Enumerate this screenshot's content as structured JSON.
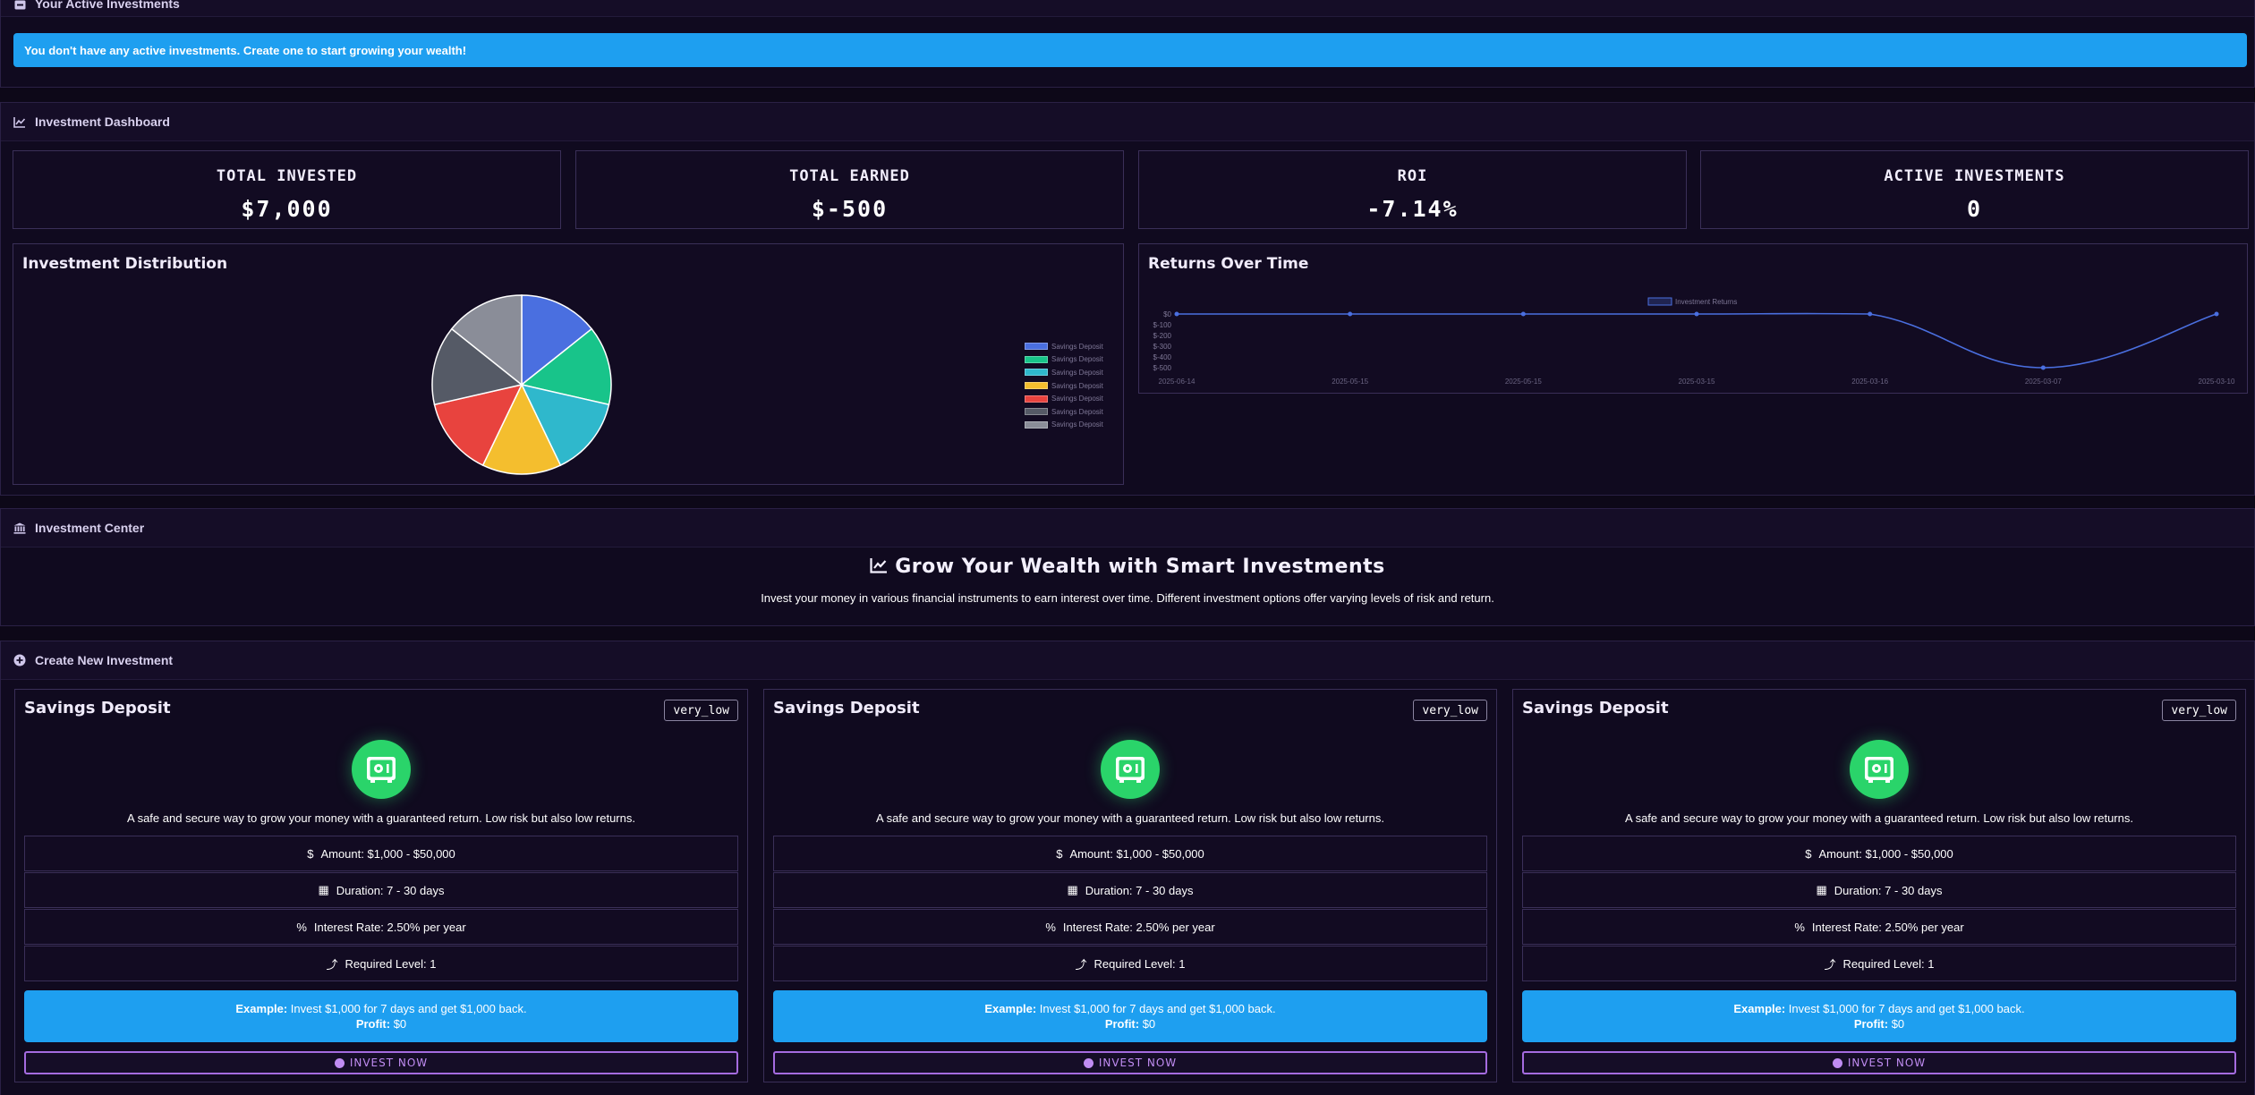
{
  "active": {
    "title": "Your Active Investments",
    "alert": "You don't have any active investments. Create one to start growing your wealth!"
  },
  "dashboard": {
    "title": "Investment Dashboard",
    "stats": [
      {
        "label": "TOTAL INVESTED",
        "value": "$7,000"
      },
      {
        "label": "TOTAL EARNED",
        "value": "$-500"
      },
      {
        "label": "ROI",
        "value": "-7.14%"
      },
      {
        "label": "ACTIVE INVESTMENTS",
        "value": "0"
      }
    ],
    "distribution": {
      "title": "Investment Distribution"
    },
    "returns": {
      "title": "Returns Over Time"
    }
  },
  "chart_data": [
    {
      "type": "pie",
      "title": "Investment Distribution",
      "labels": [
        "Savings Deposit",
        "Savings Deposit",
        "Savings Deposit",
        "Savings Deposit",
        "Savings Deposit",
        "Savings Deposit",
        "Savings Deposit"
      ],
      "values": [
        1000,
        1000,
        1000,
        1000,
        1000,
        1000,
        1000
      ],
      "colors": [
        "#4a6fe0",
        "#18c48a",
        "#2fb8cc",
        "#f4be2e",
        "#e8433e",
        "#555a66",
        "#8a8d98"
      ],
      "legend": "right"
    },
    {
      "type": "line",
      "title": "Returns Over Time",
      "series": [
        {
          "name": "Investment Returns",
          "values": [
            0,
            0,
            0,
            0,
            0,
            -500,
            0
          ]
        }
      ],
      "x": [
        "2025-06-14",
        "2025-05-15",
        "2025-05-15",
        "2025-03-15",
        "2025-03-16",
        "2025-03-07",
        "2025-03-10"
      ],
      "yticks": [
        "$0",
        "$-100",
        "$-200",
        "$-300",
        "$-400",
        "$-500"
      ],
      "ylim": [
        -500,
        0
      ],
      "color": "#4a6fe0",
      "legend": "top"
    }
  ],
  "center": {
    "title": "Investment Center",
    "headline": "Grow Your Wealth with Smart Investments",
    "subtext": "Invest your money in various financial instruments to earn interest over time. Different investment options offer varying levels of risk and return."
  },
  "create": {
    "title": "Create New Investment",
    "cards": [
      {
        "name": "Savings Deposit",
        "risk": "very_low",
        "description": "A safe and secure way to grow your money with a guaranteed return. Low risk but also low returns.",
        "amount": "Amount: $1,000 - $50,000",
        "duration": "Duration: 7 - 30 days",
        "rate": "Interest Rate: 2.50% per year",
        "level": "Required Level: 1",
        "example_label": "Example:",
        "example_text": " Invest $1,000 for 7 days and get $1,000 back.",
        "profit_label": "Profit:",
        "profit_text": " $0",
        "button": "INVEST NOW"
      },
      {
        "name": "Savings Deposit",
        "risk": "very_low",
        "description": "A safe and secure way to grow your money with a guaranteed return. Low risk but also low returns.",
        "amount": "Amount: $1,000 - $50,000",
        "duration": "Duration: 7 - 30 days",
        "rate": "Interest Rate: 2.50% per year",
        "level": "Required Level: 1",
        "example_label": "Example:",
        "example_text": " Invest $1,000 for 7 days and get $1,000 back.",
        "profit_label": "Profit:",
        "profit_text": " $0",
        "button": "INVEST NOW"
      },
      {
        "name": "Savings Deposit",
        "risk": "very_low",
        "description": "A safe and secure way to grow your money with a guaranteed return. Low risk but also low returns.",
        "amount": "Amount: $1,000 - $50,000",
        "duration": "Duration: 7 - 30 days",
        "rate": "Interest Rate: 2.50% per year",
        "level": "Required Level: 1",
        "example_label": "Example:",
        "example_text": " Invest $1,000 for 7 days and get $1,000 back.",
        "profit_label": "Profit:",
        "profit_text": " $0",
        "button": "INVEST NOW"
      }
    ]
  },
  "icons": {
    "wallet": "wallet-icon",
    "chart": "chart-line-icon",
    "bank": "bank-icon",
    "plus": "plus-circle-icon",
    "safe": "safe-icon",
    "dollar": "dollar-icon",
    "calendar": "calendar-icon",
    "percent": "percent-icon",
    "level": "level-up-icon"
  },
  "colors": {
    "background": "#0d0818",
    "alert": "#1e9ff0",
    "accent": "#a56be0",
    "safe_icon_bg": "#2ad46a"
  }
}
